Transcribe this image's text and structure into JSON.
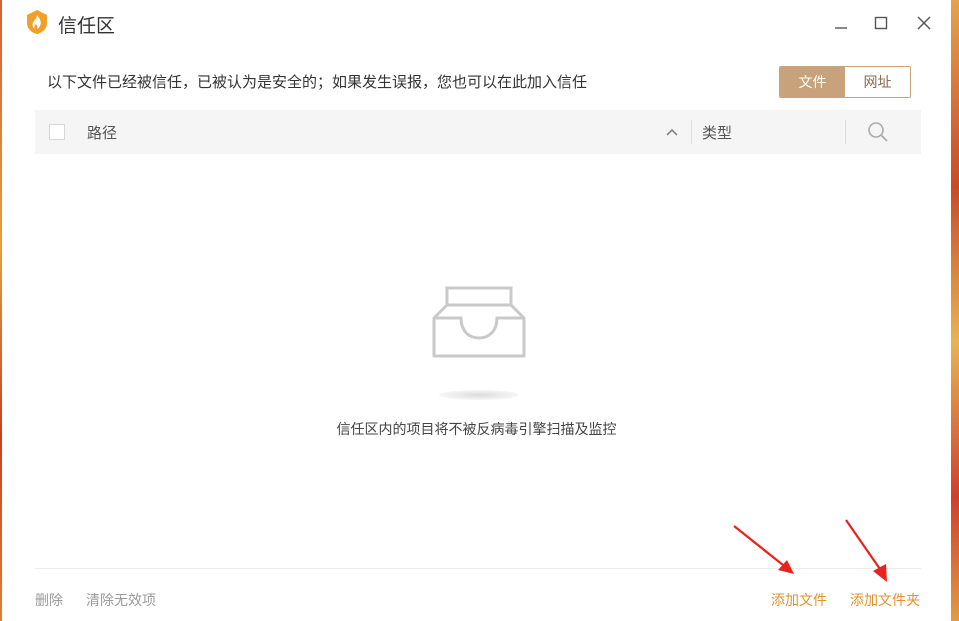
{
  "window": {
    "title": "信任区"
  },
  "header": {
    "description": "以下文件已经被信任，已被认为是安全的；如果发生误报，您也可以在此加入信任"
  },
  "tabs": [
    {
      "label": "文件",
      "active": true
    },
    {
      "label": "网址",
      "active": false
    }
  ],
  "table": {
    "columns": {
      "path": "路径",
      "type": "类型"
    }
  },
  "empty_state": {
    "message": "信任区内的项目将不被反病毒引擎扫描及监控"
  },
  "footer": {
    "delete": "删除",
    "clear_invalid": "清除无效项",
    "add_file": "添加文件",
    "add_folder": "添加文件夹"
  },
  "colors": {
    "accent": "#c8a27a",
    "link_orange": "#e2922c",
    "annotation_red": "#e8221c"
  },
  "icons": [
    "app-logo-icon",
    "minimize-icon",
    "maximize-icon",
    "close-icon",
    "sort-ascending-icon",
    "search-icon",
    "empty-tray-icon",
    "annotation-arrow-icon"
  ]
}
